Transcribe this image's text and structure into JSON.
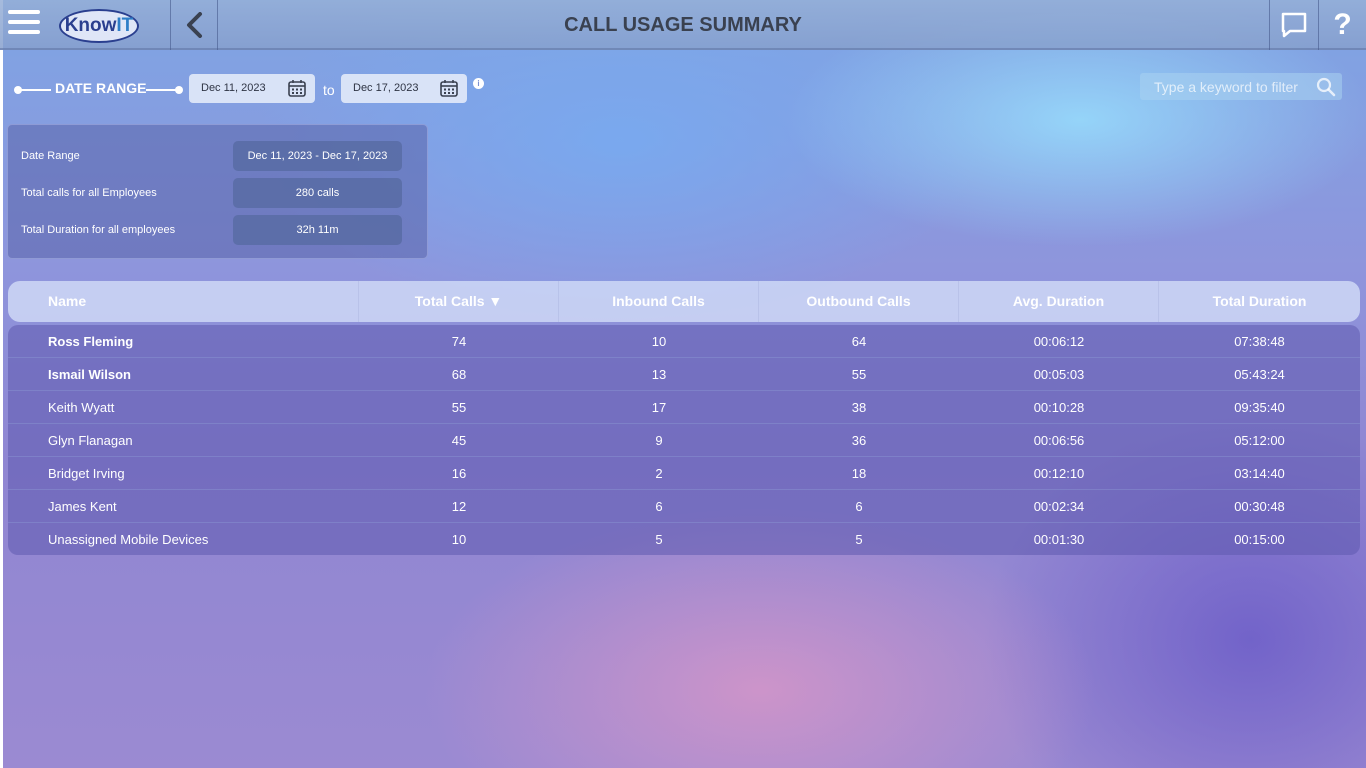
{
  "header": {
    "title": "CALL USAGE SUMMARY",
    "logo_text_1": "Know",
    "logo_text_2": "IT",
    "icons": [
      "menu-icon",
      "back-chevron-icon",
      "chat-icon",
      "help-icon"
    ],
    "help_label": "?"
  },
  "date_range": {
    "label": "DATE RANGE",
    "start": "Dec 11, 2023",
    "end": "Dec 17, 2023",
    "to_label": "to",
    "info_label": "i"
  },
  "search": {
    "placeholder": "Type a keyword to filter"
  },
  "summary": {
    "rows": [
      {
        "label": "Date Range",
        "value": "Dec 11, 2023 - Dec 17, 2023"
      },
      {
        "label": "Total calls for all Employees",
        "value": "280 calls"
      },
      {
        "label": "Total Duration for all employees",
        "value": "32h 11m"
      }
    ]
  },
  "table": {
    "columns": [
      "Name",
      "Total Calls ▼",
      "Inbound Calls",
      "Outbound Calls",
      "Avg. Duration",
      "Total Duration"
    ],
    "rows": [
      {
        "name": "Ross Fleming",
        "total": "74",
        "inbound": "10",
        "outbound": "64",
        "avg": "00:06:12",
        "duration": "07:38:48",
        "bold": true
      },
      {
        "name": "Ismail Wilson",
        "total": "68",
        "inbound": "13",
        "outbound": "55",
        "avg": "00:05:03",
        "duration": "05:43:24",
        "bold": true
      },
      {
        "name": "Keith Wyatt",
        "total": "55",
        "inbound": "17",
        "outbound": "38",
        "avg": "00:10:28",
        "duration": "09:35:40",
        "bold": false
      },
      {
        "name": "Glyn Flanagan",
        "total": "45",
        "inbound": "9",
        "outbound": "36",
        "avg": "00:06:56",
        "duration": "05:12:00",
        "bold": false
      },
      {
        "name": "Bridget Irving",
        "total": "16",
        "inbound": "2",
        "outbound": "18",
        "avg": "00:12:10",
        "duration": "03:14:40",
        "bold": false
      },
      {
        "name": "James Kent",
        "total": "12",
        "inbound": "6",
        "outbound": "6",
        "avg": "00:02:34",
        "duration": "00:30:48",
        "bold": false
      },
      {
        "name": "Unassigned Mobile Devices",
        "total": "10",
        "inbound": "5",
        "outbound": "5",
        "avg": "00:01:30",
        "duration": "00:15:00",
        "bold": false
      }
    ]
  }
}
